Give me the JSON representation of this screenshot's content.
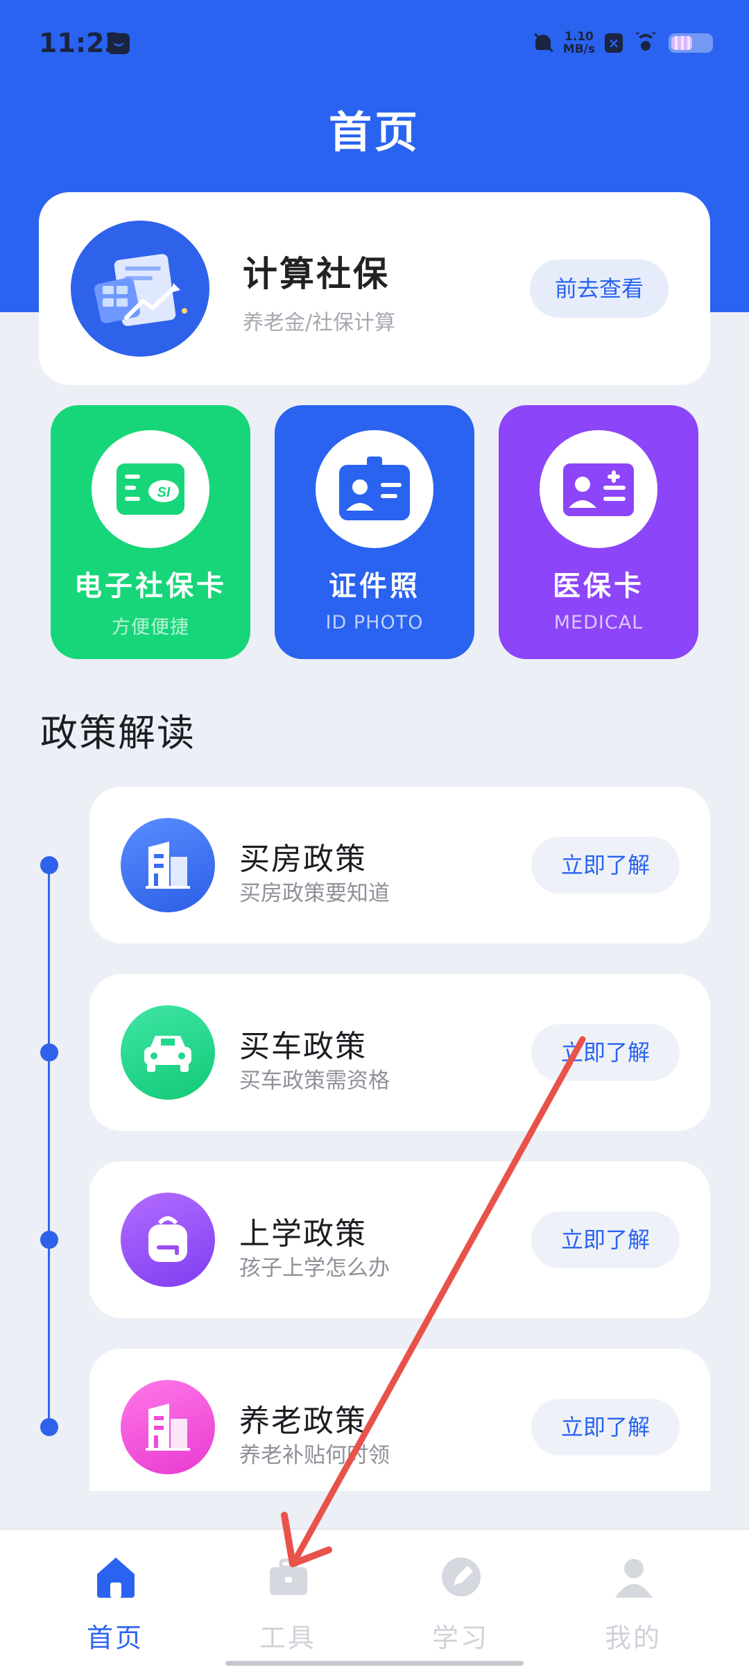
{
  "status_bar": {
    "time": "11:23",
    "net_speed_value": "1.10",
    "net_speed_unit": "MB/s"
  },
  "header": {
    "title": "首页"
  },
  "calc_card": {
    "title": "计算社保",
    "subtitle": "养老金/社保计算",
    "button": "前去查看"
  },
  "tiles": [
    {
      "title": "电子社保卡",
      "subtitle": "方便便捷",
      "color": "#17D679"
    },
    {
      "title": "证件照",
      "subtitle": "ID PHOTO",
      "color": "#2A63F0"
    },
    {
      "title": "医保卡",
      "subtitle": "MEDICAL",
      "color": "#8C45F8"
    }
  ],
  "policy_section": {
    "title": "政策解读",
    "items": [
      {
        "title": "买房政策",
        "subtitle": "买房政策要知道",
        "button": "立即了解",
        "icon": "building-icon",
        "color": "#3A6CF0"
      },
      {
        "title": "买车政策",
        "subtitle": "买车政策需资格",
        "button": "立即了解",
        "icon": "car-icon",
        "color": "#1ED98A"
      },
      {
        "title": "上学政策",
        "subtitle": "孩子上学怎么办",
        "button": "立即了解",
        "icon": "backpack-icon",
        "color": "#9B4FF2"
      },
      {
        "title": "养老政策",
        "subtitle": "养老补贴何时领",
        "button": "立即了解",
        "icon": "building-icon",
        "color": "#F04BD8"
      }
    ]
  },
  "bottom_nav": [
    {
      "label": "首页",
      "icon": "home-icon",
      "active": true
    },
    {
      "label": "工具",
      "icon": "toolbox-icon",
      "active": false
    },
    {
      "label": "学习",
      "icon": "pencil-icon",
      "active": false
    },
    {
      "label": "我的",
      "icon": "user-icon",
      "active": false
    }
  ],
  "accent_color": "#2A63F0",
  "annotation_color": "#E8524A"
}
